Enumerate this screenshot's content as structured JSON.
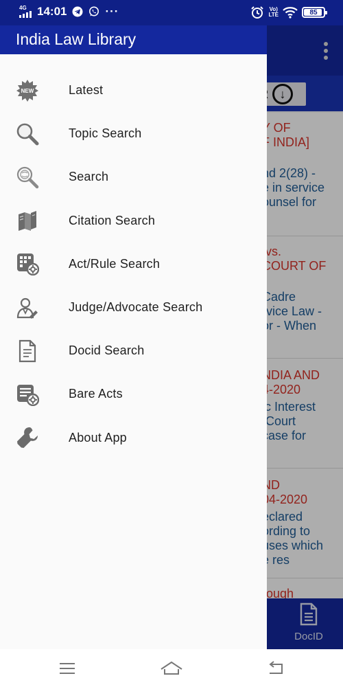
{
  "status_bar": {
    "network": "4G",
    "time": "14:01",
    "notification_icons": [
      "telegram-icon",
      "whatsapp-icon",
      "more-dots-icon"
    ],
    "more_dots": "···",
    "volte_top": "Vo)",
    "volte_bottom": "LTE",
    "battery_level": "85",
    "battery_fraction": 0.85
  },
  "drawer": {
    "title": "India Law Library",
    "items": [
      {
        "label": "Latest",
        "icon": "new-badge-icon"
      },
      {
        "label": "Topic Search",
        "icon": "magnifier-icon"
      },
      {
        "label": "Search",
        "icon": "search-globe-icon"
      },
      {
        "label": "Citation Search",
        "icon": "books-icon"
      },
      {
        "label": "Act/Rule Search",
        "icon": "grid-gear-icon"
      },
      {
        "label": "Judge/Advocate Search",
        "icon": "judge-icon"
      },
      {
        "label": "Docid Search",
        "icon": "document-icon"
      },
      {
        "label": "Bare Acts",
        "icon": "list-gear-icon"
      },
      {
        "label": "About App",
        "icon": "wrench-icon"
      }
    ]
  },
  "background_app": {
    "filter_label": "R",
    "cards": [
      {
        "title": "Y OF\nF INDIA]",
        "body": "nd 2(28) -\ne in service\nounsel for"
      },
      {
        "title": " vs.\nCOURT OF",
        "body": "Cadre\nrvice Law -\nor - When"
      },
      {
        "title": "NDIA AND\n4-2020",
        "body": "ic Interest\n Court\ncase for"
      },
      {
        "title": "ND\n04-2020",
        "body": "eclared\nording to\nuses which\ne res"
      },
      {
        "title": "rough",
        "body": ""
      }
    ],
    "bottom_tab_label": "DocID"
  },
  "nav_bar": {
    "buttons": [
      "menu-icon",
      "home-icon",
      "back-icon"
    ]
  },
  "colors": {
    "primary": "#14289e",
    "status_bar": "#0f2087",
    "accent_red": "#d8342b",
    "accent_blue_text": "#1f5c96",
    "drawer_bg": "#fafafa"
  }
}
